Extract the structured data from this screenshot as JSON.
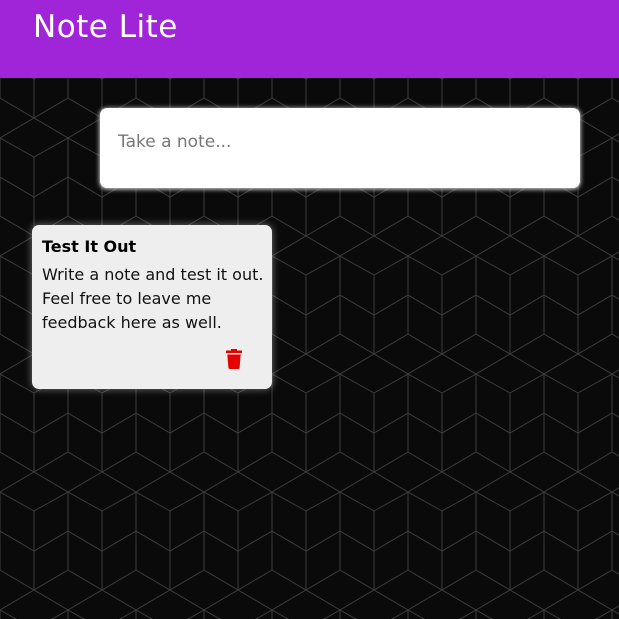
{
  "header": {
    "title": "Note Lite",
    "background_color": "#a125d8"
  },
  "create_area": {
    "placeholder": "Take a note..."
  },
  "notes": [
    {
      "title": "Test It Out",
      "content": "Write a note and test it out. Feel free to leave me feedback here as well.",
      "delete_icon": "trash-icon",
      "delete_icon_color": "#e60000"
    }
  ]
}
